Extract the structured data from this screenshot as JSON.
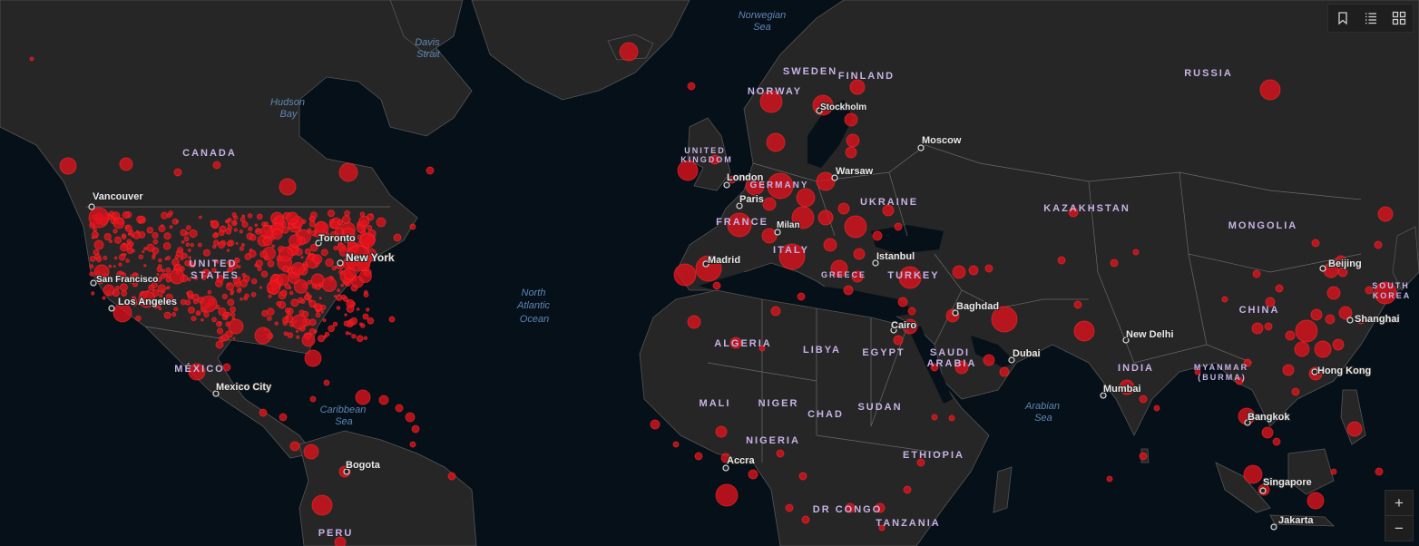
{
  "colors": {
    "ocean": "#061018",
    "land": "#262626",
    "border": "#5a5a5a",
    "case": "#e0121c",
    "country_label": "#c8b2e6",
    "water_label": "#5d86b8"
  },
  "countries": [
    {
      "name": "CANADA"
    },
    {
      "name": "UNITED"
    },
    {
      "name": "STATES"
    },
    {
      "name": "MÉXICO"
    },
    {
      "name": "PERU"
    },
    {
      "name": "UNITED"
    },
    {
      "name": "KINGDOM"
    },
    {
      "name": "NORWAY"
    },
    {
      "name": "SWEDEN"
    },
    {
      "name": "FINLAND"
    },
    {
      "name": "GERMANY"
    },
    {
      "name": "FRANCE"
    },
    {
      "name": "ITALY"
    },
    {
      "name": "UKRAINE"
    },
    {
      "name": "GREECE"
    },
    {
      "name": "TURKEY"
    },
    {
      "name": "RUSSIA"
    },
    {
      "name": "KAZAKHSTAN"
    },
    {
      "name": "MONGOLIA"
    },
    {
      "name": "CHINA"
    },
    {
      "name": "SOUTH"
    },
    {
      "name": "KOREA"
    },
    {
      "name": "INDIA"
    },
    {
      "name": "MYANMAR"
    },
    {
      "name": "(BURMA)"
    },
    {
      "name": "ALGERIA"
    },
    {
      "name": "LIBYA"
    },
    {
      "name": "EGYPT"
    },
    {
      "name": "SAUDI"
    },
    {
      "name": "ARABIA"
    },
    {
      "name": "MALI"
    },
    {
      "name": "NIGER"
    },
    {
      "name": "CHAD"
    },
    {
      "name": "SUDAN"
    },
    {
      "name": "NIGERIA"
    },
    {
      "name": "ETHIOPIA"
    },
    {
      "name": "DR CONGO"
    },
    {
      "name": "TANZANIA"
    }
  ],
  "cities": [
    {
      "name": "Vancouver"
    },
    {
      "name": "San Francisco"
    },
    {
      "name": "Los Angeles"
    },
    {
      "name": "Toronto"
    },
    {
      "name": "New York"
    },
    {
      "name": "Mexico City"
    },
    {
      "name": "Bogota"
    },
    {
      "name": "London"
    },
    {
      "name": "Paris"
    },
    {
      "name": "Madrid"
    },
    {
      "name": "Milan"
    },
    {
      "name": "Stockholm"
    },
    {
      "name": "Warsaw"
    },
    {
      "name": "Moscow"
    },
    {
      "name": "Istanbul"
    },
    {
      "name": "Cairo"
    },
    {
      "name": "Baghdad"
    },
    {
      "name": "Dubai"
    },
    {
      "name": "New Delhi"
    },
    {
      "name": "Mumbai"
    },
    {
      "name": "Beijing"
    },
    {
      "name": "Shanghai"
    },
    {
      "name": "Hong Kong"
    },
    {
      "name": "Bangkok"
    },
    {
      "name": "Singapore"
    },
    {
      "name": "Jakarta"
    },
    {
      "name": "Accra"
    }
  ],
  "water": [
    {
      "name": "Norwegian"
    },
    {
      "name": "Sea"
    },
    {
      "name": "Davis"
    },
    {
      "name": "Strait"
    },
    {
      "name": "Hudson"
    },
    {
      "name": "Bay"
    },
    {
      "name": "North"
    },
    {
      "name": "Atlantic"
    },
    {
      "name": "Ocean"
    },
    {
      "name": "Caribbean"
    },
    {
      "name": "Sea"
    },
    {
      "name": "Arabian"
    },
    {
      "name": "Sea"
    }
  ],
  "toolbar": {
    "bookmark_icon": "bookmark-icon",
    "legend_icon": "list-icon",
    "basemap_icon": "grid-icon"
  },
  "zoom": {
    "in_label": "+",
    "out_label": "−"
  }
}
